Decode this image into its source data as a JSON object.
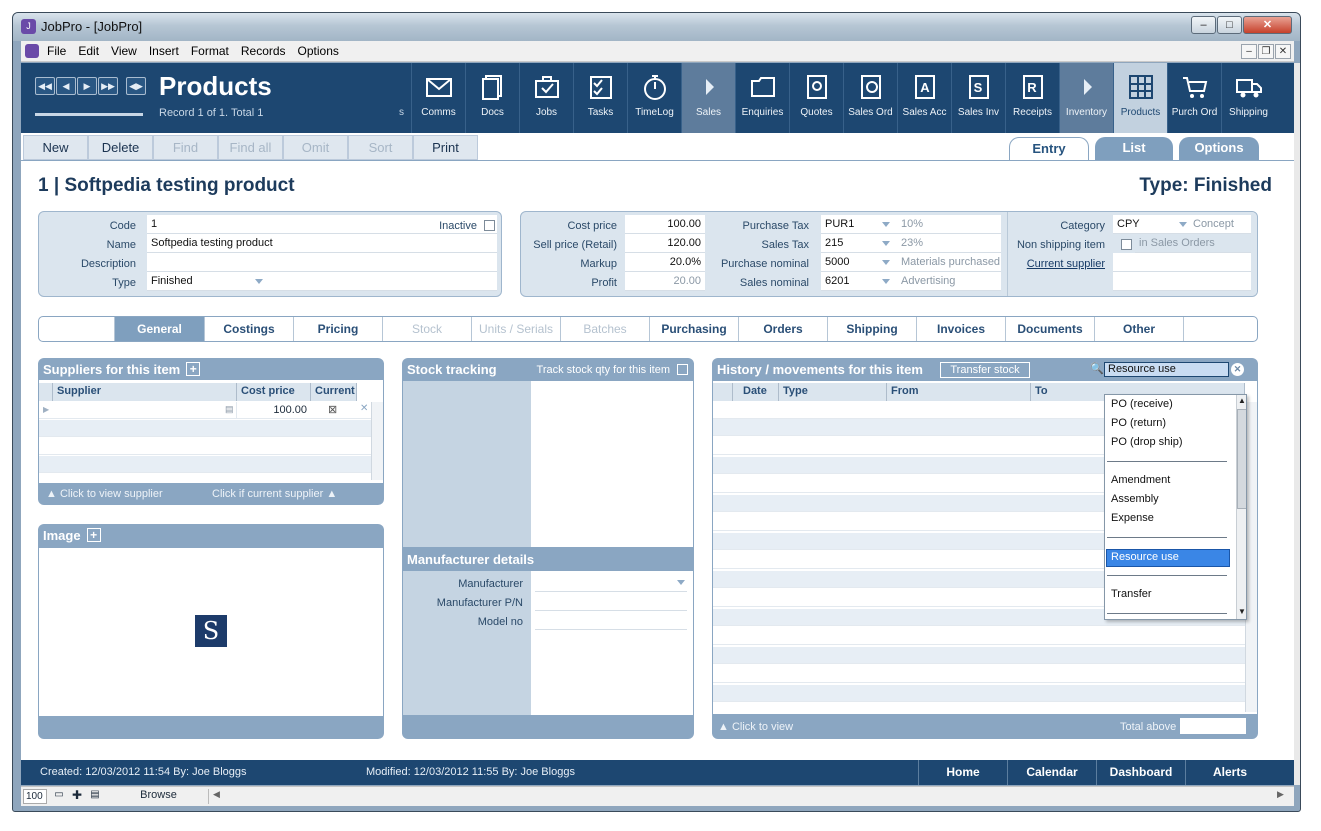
{
  "window": {
    "title": "JobPro - [JobPro]"
  },
  "menu": [
    "File",
    "Edit",
    "View",
    "Insert",
    "Format",
    "Records",
    "Options"
  ],
  "header": {
    "title": "Products",
    "record_info": "Record 1 of 1. Total 1",
    "s_label": "s",
    "nav": [
      "◀◀",
      "◀",
      "▶",
      "▶▶",
      "◀▶"
    ],
    "modules": [
      "Comms",
      "Docs",
      "Jobs",
      "Tasks",
      "TimeLog",
      "Sales",
      "Enquiries",
      "Quotes",
      "Sales Ord",
      "Sales Acc",
      "Sales Inv",
      "Receipts",
      "Inventory",
      "Products",
      "Purch Ord",
      "Shipping"
    ]
  },
  "toolbar": {
    "new": "New",
    "delete": "Delete",
    "find": "Find",
    "find_all": "Find all",
    "omit": "Omit",
    "sort": "Sort",
    "print": "Print"
  },
  "view_tabs": {
    "entry": "Entry",
    "list": "List",
    "options": "Options"
  },
  "record": {
    "title": "1 | Softpedia testing product",
    "type_heading": "Type: Finished"
  },
  "fields": {
    "code_label": "Code",
    "code": "1",
    "inactive_label": "Inactive",
    "name_label": "Name",
    "name": "Softpedia testing product",
    "description_label": "Description",
    "description": "",
    "type_label": "Type",
    "type": "Finished",
    "cost_price_label": "Cost price",
    "cost_price": "100.00",
    "sell_price_label": "Sell price (Retail)",
    "sell_price": "120.00",
    "markup_label": "Markup",
    "markup": "20.0%",
    "profit_label": "Profit",
    "profit": "20.00",
    "purchase_tax_label": "Purchase Tax",
    "purchase_tax": "PUR1",
    "purchase_tax_rate": "10%",
    "sales_tax_label": "Sales Tax",
    "sales_tax": "215",
    "sales_tax_rate": "23%",
    "purchase_nominal_label": "Purchase nominal",
    "purchase_nominal": "5000",
    "purchase_nominal_name": "Materials purchased",
    "sales_nominal_label": "Sales nominal",
    "sales_nominal": "6201",
    "sales_nominal_name": "Advertising",
    "category_label": "Category",
    "category": "CPY",
    "category_name": "Concept",
    "non_shipping_label": "Non shipping item",
    "in_sales_orders": "in Sales Orders",
    "current_supplier_link": "Current supplier"
  },
  "section_tabs": [
    "General",
    "Costings",
    "Pricing",
    "Stock",
    "Units / Serials",
    "Batches",
    "Purchasing",
    "Orders",
    "Shipping",
    "Invoices",
    "Documents",
    "Other"
  ],
  "suppliers": {
    "title": "Suppliers for this item",
    "columns": [
      "Supplier",
      "Cost price",
      "Current"
    ],
    "rows": [
      {
        "supplier": "",
        "cost_price": "100.00"
      }
    ],
    "footer_left": "Click to view supplier",
    "footer_right": "Click if current supplier"
  },
  "image_box": {
    "title": "Image",
    "logo_letter": "S"
  },
  "stock": {
    "title": "Stock tracking",
    "track_label": "Track stock qty for this item"
  },
  "manufacturer": {
    "title": "Manufacturer details",
    "manufacturer_label": "Manufacturer",
    "pn_label": "Manufacturer P/N",
    "model_label": "Model no"
  },
  "history": {
    "title": "History / movements for this item",
    "transfer_button": "Transfer stock",
    "filter_value": "Resource use",
    "columns": [
      "Date",
      "Type",
      "From",
      "To"
    ],
    "footer_left": "Click to view",
    "total_label": "Total above"
  },
  "dropdown": {
    "items": [
      "PO (receive)",
      "PO (return)",
      "PO (drop ship)",
      "Amendment",
      "Assembly",
      "Expense",
      "Resource use",
      "Transfer"
    ],
    "selected": "Resource use"
  },
  "status": {
    "created": "Created:  12/03/2012   11:54    By:  Joe Bloggs",
    "modified": "Modified:  12/03/2012   11:55    By:  Joe Bloggs",
    "buttons": [
      "Home",
      "Calendar",
      "Dashboard",
      "Alerts"
    ]
  },
  "bottom": {
    "zoom": "100",
    "mode": "Browse"
  }
}
